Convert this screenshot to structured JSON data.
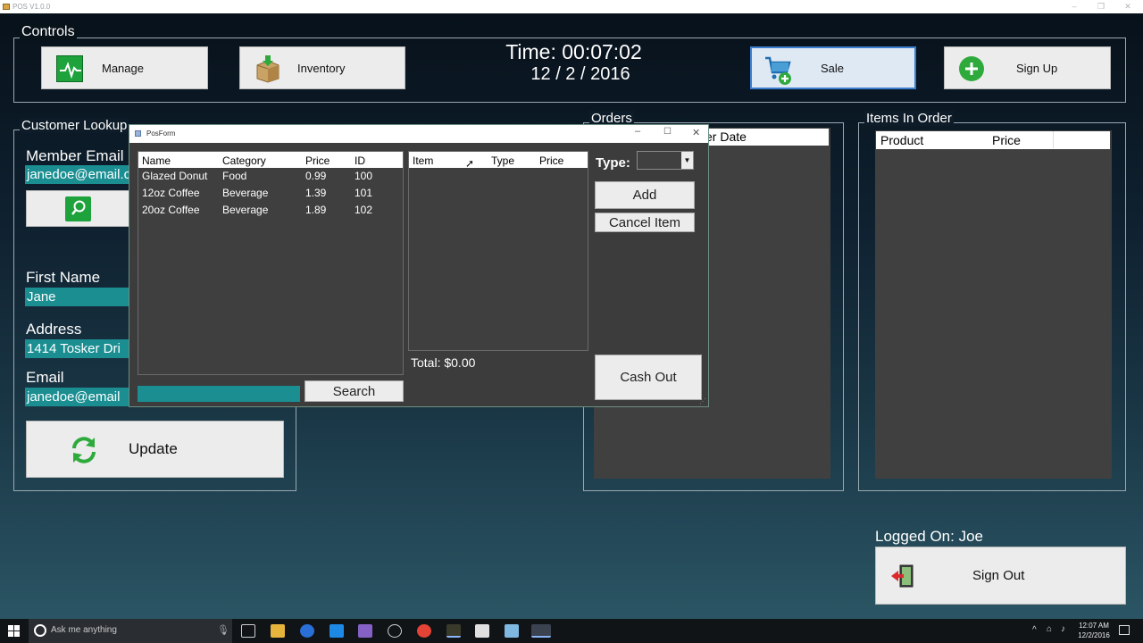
{
  "window": {
    "title": "POS V1.0.0"
  },
  "controls": {
    "label": "Controls",
    "manage_label": "Manage",
    "inventory_label": "Inventory",
    "sale_label": "Sale",
    "signup_label": "Sign Up",
    "time": "Time: 00:07:02",
    "date": "12 / 2 / 2016"
  },
  "customer": {
    "label": "Customer Lookup",
    "member_email_label": "Member Email",
    "member_email_value": "janedoe@email.c",
    "first_name_label": "First Name",
    "first_name_value": "Jane",
    "address_label": "Address",
    "address_value": "1414 Tosker Dri",
    "email_label": "Email",
    "email_value": "janedoe@email",
    "update_label": "Update"
  },
  "orders": {
    "label": "Orders",
    "header_partial": "er Date"
  },
  "items_in_order": {
    "label": "Items In Order",
    "columns": [
      "Product",
      "Price"
    ]
  },
  "logged_on": "Logged On: Joe",
  "signout_label": "Sign Out",
  "posform": {
    "title": "PosForm",
    "product_columns": [
      "Name",
      "Category",
      "Price",
      "ID"
    ],
    "products": [
      [
        "Glazed Donut",
        "Food",
        "0.99",
        "100"
      ],
      [
        "12oz Coffee",
        "Beverage",
        "1.39",
        "101"
      ],
      [
        "20oz Coffee",
        "Beverage",
        "1.89",
        "102"
      ]
    ],
    "cart_columns": [
      "Item",
      "Type",
      "Price"
    ],
    "type_label": "Type:",
    "add_label": "Add",
    "cancel_label": "Cancel Item",
    "total": "Total: $0.00",
    "cashout_label": "Cash Out",
    "search_label": "Search",
    "search_value": ""
  },
  "taskbar": {
    "search_placeholder": "Ask me anything",
    "time": "12:07 AM",
    "date": "12/2/2016"
  },
  "colors": {
    "field_teal": "#1a8e91",
    "panel_dark": "#404040",
    "tile_bg": "#ececec",
    "sale_tile_bg": "#dfe9f4"
  }
}
